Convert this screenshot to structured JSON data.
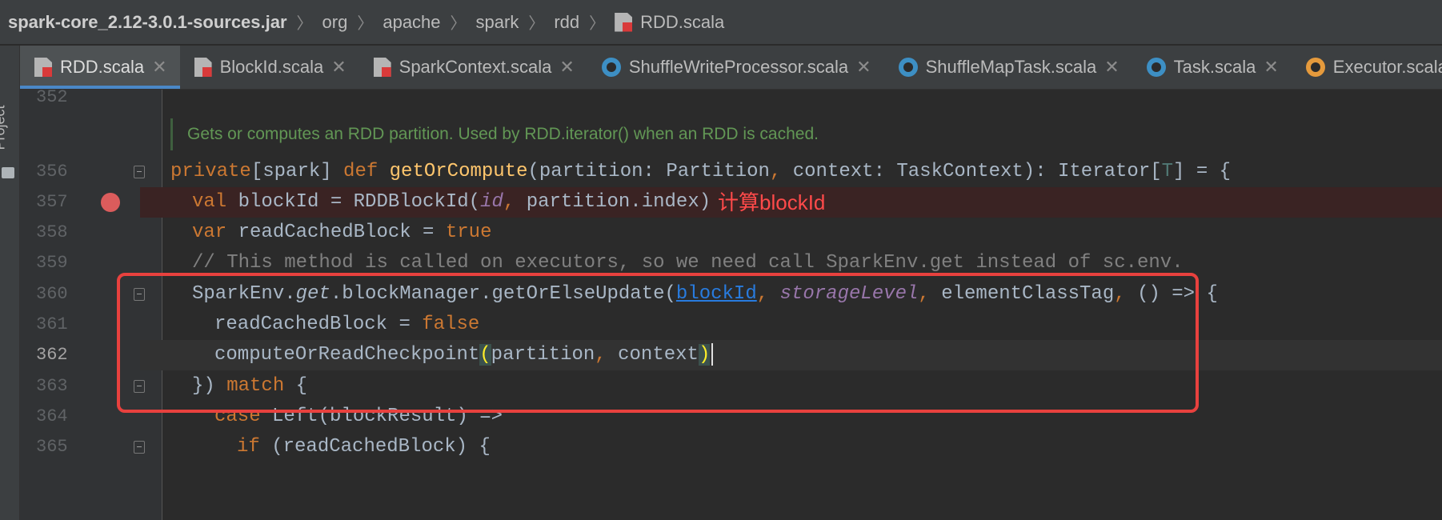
{
  "breadcrumb": {
    "jar": "spark-core_2.12-3.0.1-sources.jar",
    "p1": "org",
    "p2": "apache",
    "p3": "spark",
    "p4": "rdd",
    "file": "RDD.scala",
    "separator": "〉"
  },
  "sidebar": {
    "project_label": "Project"
  },
  "tabs": [
    {
      "label": "RDD.scala",
      "icon": "scala-file-icon",
      "active": true
    },
    {
      "label": "BlockId.scala",
      "icon": "scala-file-icon"
    },
    {
      "label": "SparkContext.scala",
      "icon": "scala-file-icon"
    },
    {
      "label": "ShuffleWriteProcessor.scala",
      "icon": "class-icon"
    },
    {
      "label": "ShuffleMapTask.scala",
      "icon": "class-icon"
    },
    {
      "label": "Task.scala",
      "icon": "class-icon"
    },
    {
      "label": "Executor.scala",
      "icon": "class-icon"
    }
  ],
  "tab_close_glyph": "✕",
  "editor": {
    "doc_comment": "Gets or computes an RDD partition. Used by RDD.iterator() when an RDD is cached.",
    "annotation": "计算blockId",
    "lines": {
      "l352": {
        "num": "352"
      },
      "l356": {
        "num": "356",
        "t1": "private",
        "t2": "[spark] ",
        "t3": "def ",
        "t4": "getOrCompute",
        "t5": "(partition: Partition",
        "t6": ", ",
        "t7": "context: TaskContext): Iterator[",
        "t8": "T",
        "t9": "] = {"
      },
      "l357": {
        "num": "357",
        "t1": "val ",
        "t2": "blockId = RDDBlockId(",
        "t3": "id",
        "t4": ", ",
        "t5": "partition.index)"
      },
      "l358": {
        "num": "358",
        "t1": "var ",
        "t2": "readCachedBlock = ",
        "t3": "true"
      },
      "l359": {
        "num": "359",
        "t1": "// This method is called on executors, so we need call SparkEnv.get instead of sc.env."
      },
      "l360": {
        "num": "360",
        "t1": "SparkEnv.",
        "t2": "get",
        "t3": ".blockManager.getOrElseUpdate(",
        "t4": "blockId",
        "t5": ", ",
        "t6": "storageLevel",
        "t7": ", ",
        "t8": "elementClassTag",
        "t9": ", ",
        "t10": "() => {"
      },
      "l361": {
        "num": "361",
        "t1": "readCachedBlock = ",
        "t2": "false"
      },
      "l362": {
        "num": "362",
        "t1": "computeOrReadCheckpoint",
        "t2": "(",
        "t3": "partition",
        "t4": ", ",
        "t5": "context",
        "t6": ")"
      },
      "l363": {
        "num": "363",
        "t1": "}) ",
        "t2": "match ",
        "t3": "{"
      },
      "l364": {
        "num": "364",
        "t1": "case ",
        "t2": "Left(blockResult) =>"
      },
      "l365": {
        "num": "365",
        "t1": "if ",
        "t2": "(readCachedBlock) {"
      }
    }
  },
  "colors": {
    "background": "#2b2b2b",
    "keyword": "#cc7832",
    "function": "#ffc66d",
    "comment": "#808080",
    "doc_comment": "#629755",
    "field": "#9876aa",
    "breakpoint": "#db5c5c",
    "highlight_box": "#e8413e",
    "annotation": "#ff4a4a"
  }
}
